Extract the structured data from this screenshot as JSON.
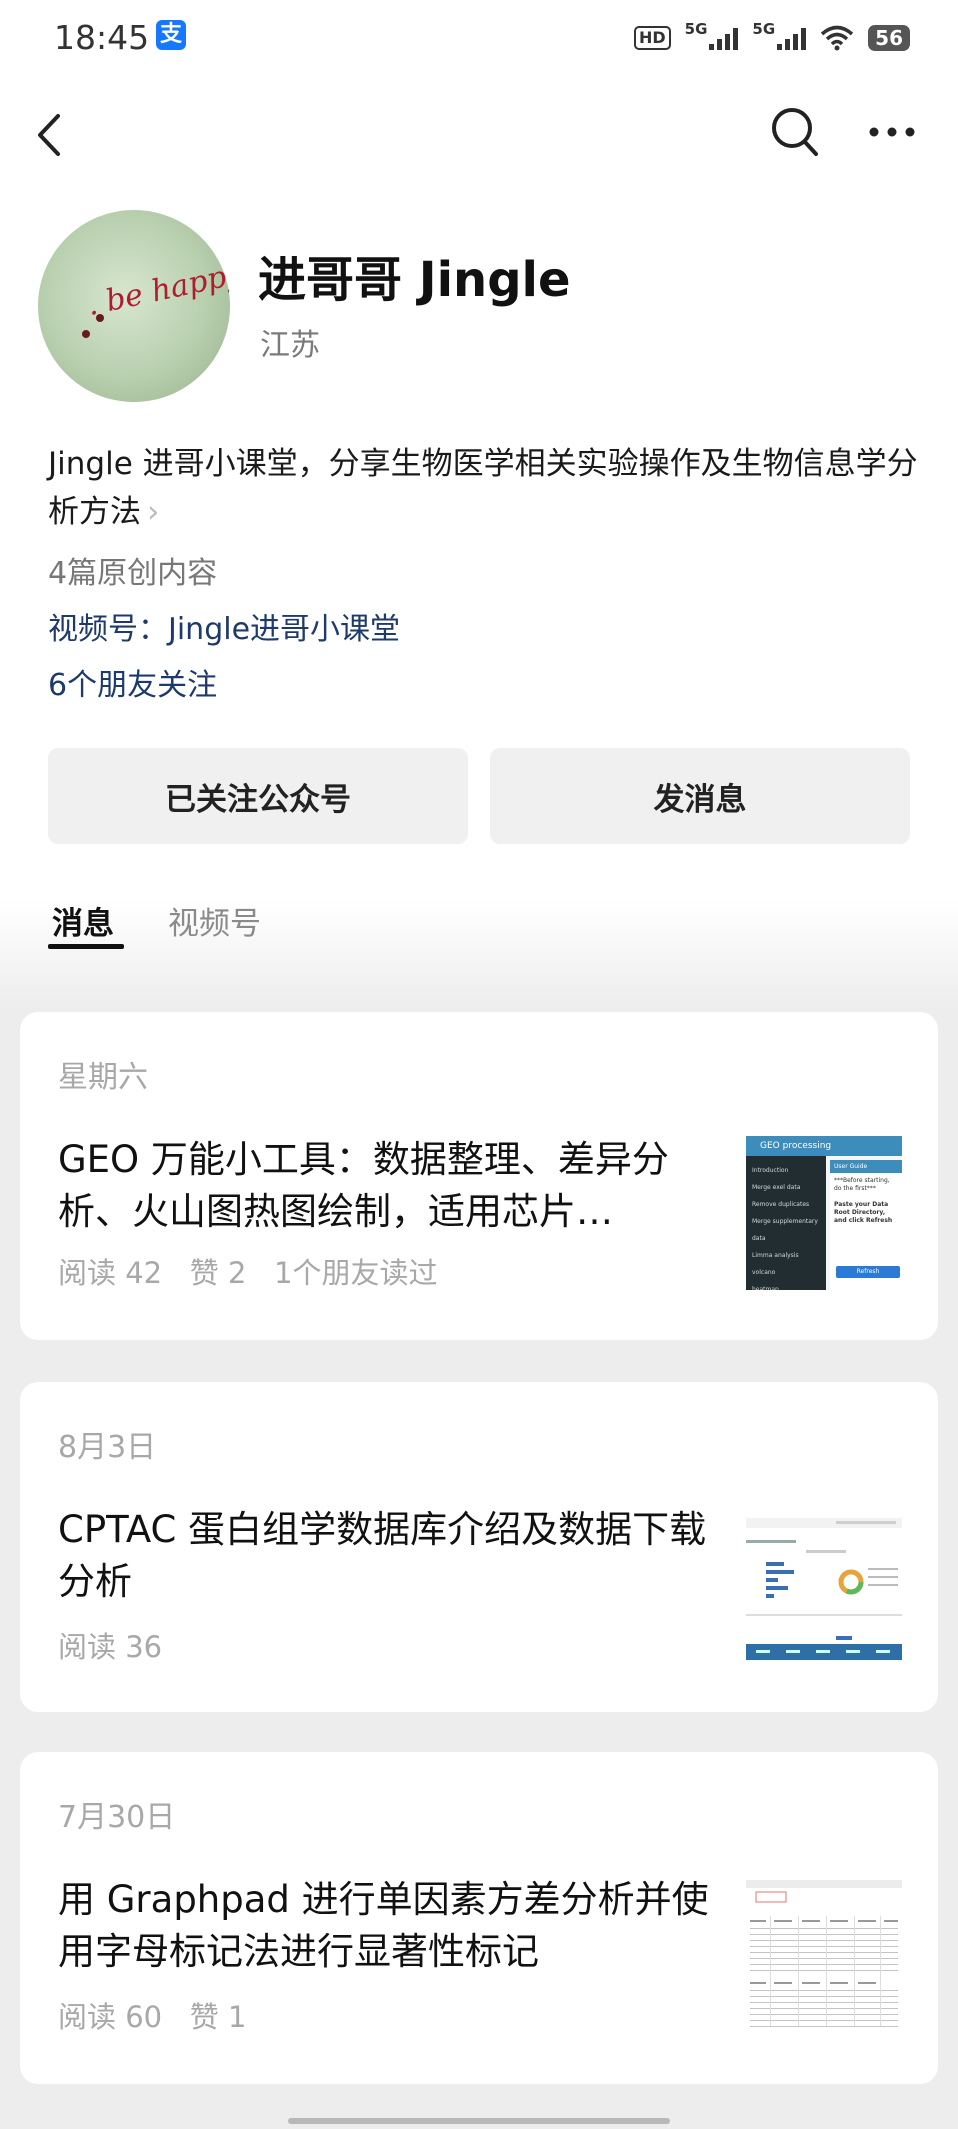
{
  "status_bar": {
    "time": "18:45",
    "hd": "HD",
    "net1": "5G",
    "net2": "5G",
    "battery": "56"
  },
  "nav": {
    "back_icon": "chevron-left-icon",
    "search_icon": "search-icon",
    "more_icon": "more-horizontal-icon"
  },
  "profile": {
    "name": "进哥哥 Jingle",
    "region": "江苏",
    "description": "Jingle 进哥小课堂，分享生物医学相关实验操作及生物信息学分析方法",
    "original_count": "4篇原创内容",
    "channel": "视频号：Jingle进哥小课堂",
    "friends_following": "6个朋友关注",
    "avatar_text": ". be happy"
  },
  "actions": {
    "followed_label": "已关注公众号",
    "message_label": "发消息"
  },
  "tabs": [
    {
      "label": "消息",
      "active": true
    },
    {
      "label": "视频号",
      "active": false
    }
  ],
  "articles": [
    {
      "date": "星期六",
      "title": "GEO 万能小工具：数据整理、差异分析、火山图热图绘制，适用芯片…",
      "meta": "阅读 42   赞 2   1个朋友读过",
      "thumb": {
        "header": "GEO processing",
        "menu": [
          "Introduction",
          "Merge exel data",
          "Remove duplicates",
          "Merge supplementary data",
          "Limma analysis",
          "volcano",
          "heatmap"
        ],
        "panel_title": "User Guide",
        "panel_text": "***Before starting, do the first***",
        "panel_text2": "Paste your Data Root Directory, and click Refresh",
        "button": "Refresh"
      }
    },
    {
      "date": "8月3日",
      "title": "CPTAC 蛋白组学数据库介绍及数据下载分析",
      "meta": "阅读 36"
    },
    {
      "date": "7月30日",
      "title": "用 Graphpad 进行单因素方差分析并使用字母标记法进行显著性标记",
      "meta": "阅读 60   赞 1"
    }
  ]
}
